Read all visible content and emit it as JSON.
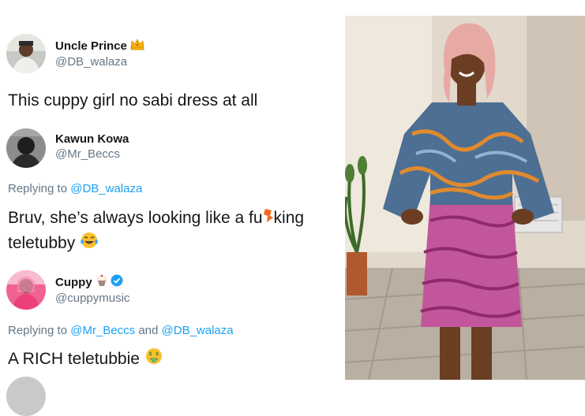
{
  "tweets": [
    {
      "display_name": "Uncle Prince",
      "name_emoji": "crown-icon",
      "handle": "@DB_walaza",
      "text": "This cuppy girl no sabi dress at all"
    },
    {
      "display_name": "Kawun Kowa",
      "handle": "@Mr_Beccs",
      "replying_prefix": "Replying to",
      "replying_to": "@DB_walaza",
      "text_line1_start": "Bruv, she’s always looking like a fu",
      "text_line1_end": "king",
      "text_line2": "teletubby",
      "text_emoji": "tears-of-joy-icon"
    },
    {
      "display_name": "Cuppy",
      "name_emoji": "cupcake-icon",
      "verified": true,
      "handle": "@cuppymusic",
      "replying_prefix": "Replying to",
      "replying_to_1": "@Mr_Beccs",
      "replying_and": "and",
      "replying_to_2": "@DB_walaza",
      "text": "A RICH teletubbie",
      "text_emoji": "money-mouth-icon"
    }
  ],
  "colors": {
    "handle": "#657786",
    "link": "#1da1f2",
    "text": "#14171a",
    "censor": "#f36b21"
  }
}
